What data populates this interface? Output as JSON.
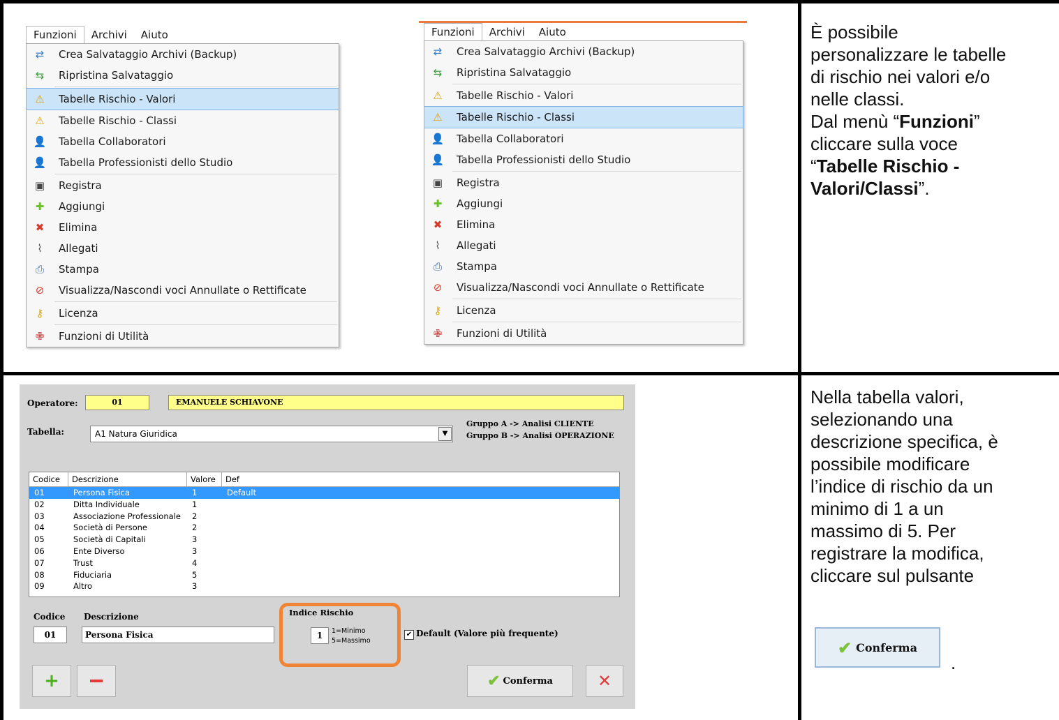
{
  "menu_left": {
    "menubar": [
      "Funzioni",
      "Archivi",
      "Aiuto"
    ],
    "items": [
      {
        "label": "Crea Salvataggio Archivi (Backup)",
        "icon": "backup-icon"
      },
      {
        "label": "Ripristina Salvataggio",
        "icon": "restore-icon"
      },
      {
        "label": "Tabelle Rischio - Valori",
        "icon": "warning-table-icon"
      },
      {
        "label": "Tabelle Rischio - Classi",
        "icon": "warning-table-icon"
      },
      {
        "label": "Tabella Collaboratori",
        "icon": "user-doc-icon"
      },
      {
        "label": "Tabella Professionisti dello Studio",
        "icon": "user-doc-icon"
      },
      {
        "label": "Registra",
        "icon": "save-icon"
      },
      {
        "label": "Aggiungi",
        "icon": "plus-icon"
      },
      {
        "label": "Elimina",
        "icon": "delete-icon"
      },
      {
        "label": "Allegati",
        "icon": "paperclip-icon"
      },
      {
        "label": "Stampa",
        "icon": "printer-icon"
      },
      {
        "label": "Visualizza/Nascondi voci Annullate o Rettificate",
        "icon": "hide-icon"
      },
      {
        "label": "Licenza",
        "icon": "key-icon"
      },
      {
        "label": "Funzioni di Utilità",
        "icon": "toolkit-icon"
      }
    ],
    "selected": "Tabelle Rischio - Valori"
  },
  "menu_right": {
    "menubar": [
      "Funzioni",
      "Archivi",
      "Aiuto"
    ],
    "items": [
      {
        "label": "Crea Salvataggio Archivi (Backup)",
        "icon": "backup-icon"
      },
      {
        "label": "Ripristina Salvataggio",
        "icon": "restore-icon"
      },
      {
        "label": "Tabelle Rischio - Valori",
        "icon": "warning-table-icon"
      },
      {
        "label": "Tabelle Rischio - Classi",
        "icon": "warning-table-icon"
      },
      {
        "label": "Tabella Collaboratori",
        "icon": "user-doc-icon"
      },
      {
        "label": "Tabella Professionisti dello Studio",
        "icon": "user-doc-icon"
      },
      {
        "label": "Registra",
        "icon": "save-icon"
      },
      {
        "label": "Aggiungi",
        "icon": "plus-icon"
      },
      {
        "label": "Elimina",
        "icon": "delete-icon"
      },
      {
        "label": "Allegati",
        "icon": "paperclip-icon"
      },
      {
        "label": "Stampa",
        "icon": "printer-icon"
      },
      {
        "label": "Visualizza/Nascondi voci Annullate o Rettificate",
        "icon": "hide-icon"
      },
      {
        "label": "Licenza",
        "icon": "key-icon"
      },
      {
        "label": "Funzioni di Utilità",
        "icon": "toolkit-icon"
      }
    ],
    "selected": "Tabelle Rischio - Classi"
  },
  "text_top": {
    "l1": "È possibile",
    "l2": "personalizzare le tabelle",
    "l3": "di rischio nei valori e/o",
    "l4": "nelle classi.",
    "l5_pre": "Dal menù “",
    "l5_bold": "Funzioni",
    "l5_post": "”",
    "l6": "cliccare sulla voce",
    "l7_pre": "“",
    "l7_bold": "Tabelle Rischio -",
    "l8_bold": "Valori/Classi",
    "l8_post": "”."
  },
  "text_bottom": {
    "l1": "Nella tabella valori,",
    "l2": "selezionando una",
    "l3": "descrizione specifica, è",
    "l4": "possibile modificare",
    "l5": "l’indice di rischio da un",
    "l6": "minimo di 1 a un",
    "l7": "massimo di 5. Per",
    "l8": "registrare la modifica,",
    "l9": "cliccare sul pulsante",
    "button_label": "Conferma",
    "period": "."
  },
  "form": {
    "operatore_label": "Operatore:",
    "operatore_code": "01",
    "operatore_name": "EMANUELE SCHIAVONE",
    "tabella_label": "Tabella:",
    "tabella_value": "A1 Natura Giuridica",
    "gruppo_a": "Gruppo A -> Analisi CLIENTE",
    "gruppo_b": "Gruppo B -> Analisi OPERAZIONE",
    "columns": [
      "Codice",
      "Descrizione",
      "Valore",
      "Def"
    ],
    "rows": [
      {
        "codice": "01",
        "descrizione": "Persona Fisica",
        "valore": "1",
        "def": "Default"
      },
      {
        "codice": "02",
        "descrizione": "Ditta Individuale",
        "valore": "1",
        "def": ""
      },
      {
        "codice": "03",
        "descrizione": "Associazione Professionale",
        "valore": "2",
        "def": ""
      },
      {
        "codice": "04",
        "descrizione": "Società di Persone",
        "valore": "2",
        "def": ""
      },
      {
        "codice": "05",
        "descrizione": "Società di Capitali",
        "valore": "3",
        "def": ""
      },
      {
        "codice": "06",
        "descrizione": "Ente Diverso",
        "valore": "3",
        "def": ""
      },
      {
        "codice": "07",
        "descrizione": "Trust",
        "valore": "4",
        "def": ""
      },
      {
        "codice": "08",
        "descrizione": "Fiduciaria",
        "valore": "5",
        "def": ""
      },
      {
        "codice": "09",
        "descrizione": "Altro",
        "valore": "3",
        "def": ""
      }
    ],
    "codice_label": "Codice",
    "descrizione_label": "Descrizione",
    "codice_value": "01",
    "descrizione_value": "Persona Fisica",
    "indice_label": "Indice Rischio",
    "indice_value": "1",
    "min_hint": "1=Minimo",
    "max_hint": "5=Massimo",
    "default_label": "Default (Valore più frequente)",
    "conferma_label": "Conferma"
  }
}
